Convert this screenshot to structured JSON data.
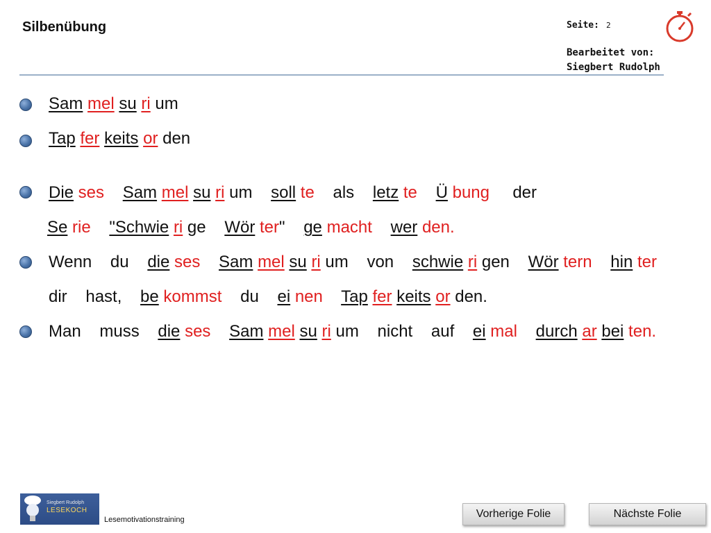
{
  "header": {
    "title": "Silbenübung",
    "seite_label": "Seite:",
    "seite_number": "2",
    "edited_label": "Bearbeitet von:",
    "edited_name": "Siegbert Rudolph"
  },
  "lines": [
    {
      "segments": [
        {
          "t": "Sam",
          "c": "black",
          "u": true
        },
        {
          "t": " "
        },
        {
          "t": "mel",
          "c": "red",
          "u": true
        },
        {
          "t": " "
        },
        {
          "t": "su",
          "c": "black",
          "u": true
        },
        {
          "t": " "
        },
        {
          "t": "ri",
          "c": "red",
          "u": true
        },
        {
          "t": " um"
        }
      ]
    },
    {
      "segments": [
        {
          "t": "Tap",
          "c": "black",
          "u": true
        },
        {
          "t": " "
        },
        {
          "t": "fer",
          "c": "red",
          "u": true
        },
        {
          "t": " "
        },
        {
          "t": "keits",
          "c": "black",
          "u": true
        },
        {
          "t": " "
        },
        {
          "t": "or",
          "c": "red",
          "u": true
        },
        {
          "t": " den"
        }
      ]
    },
    {
      "segments": [
        {
          "t": "Die",
          "c": "black",
          "u": true
        },
        {
          "t": " ses",
          "c": "red"
        },
        {
          "t": "    "
        },
        {
          "t": "Sam",
          "c": "black",
          "u": true
        },
        {
          "t": " "
        },
        {
          "t": "mel",
          "c": "red",
          "u": true
        },
        {
          "t": " "
        },
        {
          "t": "su",
          "c": "black",
          "u": true
        },
        {
          "t": " "
        },
        {
          "t": "ri",
          "c": "red",
          "u": true
        },
        {
          "t": " um    "
        },
        {
          "t": "soll",
          "c": "black",
          "u": true
        },
        {
          "t": " te",
          "c": "red"
        },
        {
          "t": "    als    "
        },
        {
          "t": "letz",
          "c": "black",
          "u": true
        },
        {
          "t": " te",
          "c": "red"
        },
        {
          "t": "    "
        },
        {
          "t": "Ü",
          "c": "black",
          "u": true
        },
        {
          "t": " bung",
          "c": "red"
        },
        {
          "t": "     der"
        }
      ]
    },
    {
      "segments": [
        {
          "t": "Se",
          "c": "black",
          "u": true
        },
        {
          "t": " rie",
          "c": "red"
        },
        {
          "t": "    "
        },
        {
          "t": "\"Schwie",
          "c": "black",
          "u": true
        },
        {
          "t": " "
        },
        {
          "t": "ri",
          "c": "red",
          "u": true
        },
        {
          "t": " ge    "
        },
        {
          "t": "Wör",
          "c": "black",
          "u": true
        },
        {
          "t": " ter",
          "c": "red"
        },
        {
          "t": "\"    "
        },
        {
          "t": "ge",
          "c": "black",
          "u": true
        },
        {
          "t": " macht",
          "c": "red"
        },
        {
          "t": "    "
        },
        {
          "t": "wer",
          "c": "black",
          "u": true
        },
        {
          "t": " den.",
          "c": "red"
        }
      ]
    },
    {
      "segments": [
        {
          "t": "Wenn    du    "
        },
        {
          "t": "die",
          "c": "black",
          "u": true
        },
        {
          "t": " ses",
          "c": "red"
        },
        {
          "t": "    "
        },
        {
          "t": "Sam",
          "c": "black",
          "u": true
        },
        {
          "t": " "
        },
        {
          "t": "mel",
          "c": "red",
          "u": true
        },
        {
          "t": " "
        },
        {
          "t": "su",
          "c": "black",
          "u": true
        },
        {
          "t": " "
        },
        {
          "t": "ri",
          "c": "red",
          "u": true
        },
        {
          "t": " um    von    "
        },
        {
          "t": "schwie",
          "c": "black",
          "u": true
        },
        {
          "t": " "
        },
        {
          "t": "ri",
          "c": "red",
          "u": true
        },
        {
          "t": " gen    "
        },
        {
          "t": "Wör",
          "c": "black",
          "u": true
        },
        {
          "t": " tern",
          "c": "red"
        },
        {
          "t": "    "
        },
        {
          "t": "hin",
          "c": "black",
          "u": true
        },
        {
          "t": " ter",
          "c": "red"
        }
      ]
    },
    {
      "segments": [
        {
          "t": "dir    hast,    "
        },
        {
          "t": "be",
          "c": "black",
          "u": true
        },
        {
          "t": " kommst",
          "c": "red"
        },
        {
          "t": "    du    "
        },
        {
          "t": "ei",
          "c": "black",
          "u": true
        },
        {
          "t": " nen",
          "c": "red"
        },
        {
          "t": "    "
        },
        {
          "t": "Tap",
          "c": "black",
          "u": true
        },
        {
          "t": " "
        },
        {
          "t": "fer",
          "c": "red",
          "u": true
        },
        {
          "t": " "
        },
        {
          "t": "keits",
          "c": "black",
          "u": true
        },
        {
          "t": " "
        },
        {
          "t": "or",
          "c": "red",
          "u": true
        },
        {
          "t": " den."
        }
      ]
    },
    {
      "segments": [
        {
          "t": "Man    muss    "
        },
        {
          "t": "die",
          "c": "black",
          "u": true
        },
        {
          "t": " ses",
          "c": "red"
        },
        {
          "t": "    "
        },
        {
          "t": "Sam",
          "c": "black",
          "u": true
        },
        {
          "t": " "
        },
        {
          "t": "mel",
          "c": "red",
          "u": true
        },
        {
          "t": " "
        },
        {
          "t": "su",
          "c": "black",
          "u": true
        },
        {
          "t": " "
        },
        {
          "t": "ri",
          "c": "red",
          "u": true
        },
        {
          "t": " um    nicht    auf    "
        },
        {
          "t": "ei",
          "c": "black",
          "u": true
        },
        {
          "t": " mal",
          "c": "red"
        },
        {
          "t": "    "
        },
        {
          "t": "durch",
          "c": "black",
          "u": true
        },
        {
          "t": " "
        },
        {
          "t": "ar",
          "c": "red",
          "u": true
        },
        {
          "t": " "
        },
        {
          "t": "bei",
          "c": "black",
          "u": true
        },
        {
          "t": " ten.",
          "c": "red"
        }
      ]
    }
  ],
  "footer": {
    "logo_name": "Siegbert Rudolph",
    "logo_brand": "LESEKOCH",
    "tagline": "Lesemotivationstraining",
    "prev_label": "Vorherige Folie",
    "next_label": "Nächste Folie"
  },
  "colors": {
    "accent_red": "#e02020",
    "bullet_blue": "#4a73a8",
    "stopwatch_red": "#d93a2b"
  },
  "icons": {
    "stopwatch": "stopwatch-icon",
    "bullet": "bullet-icon"
  }
}
